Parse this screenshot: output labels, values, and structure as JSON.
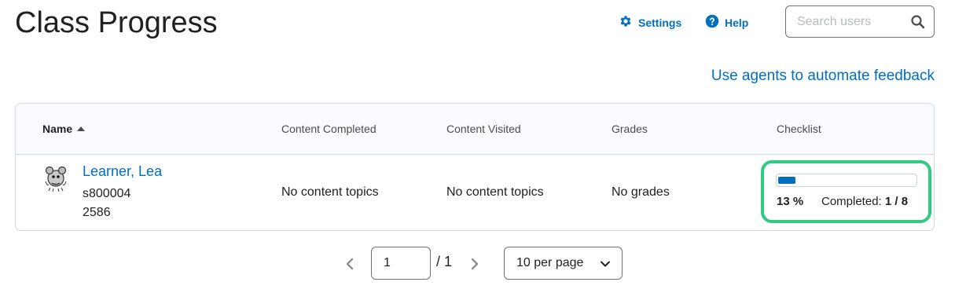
{
  "header": {
    "title": "Class Progress",
    "settings_label": "Settings",
    "help_label": "Help",
    "search_placeholder": "Search users",
    "search_value": "",
    "agents_link": "Use agents to automate feedback"
  },
  "table": {
    "columns": {
      "name": "Name",
      "content_completed": "Content Completed",
      "content_visited": "Content Visited",
      "grades": "Grades",
      "checklist": "Checklist"
    },
    "rows": [
      {
        "name": "Learner, Lea",
        "user_id": "s800004",
        "org_id": "2586",
        "content_completed": "No content topics",
        "content_visited": "No content topics",
        "grades": "No grades",
        "checklist": {
          "percent_label": "13 %",
          "completed_label": "Completed:",
          "completed_value": "1 / 8",
          "progress_fraction": 0.125
        }
      }
    ]
  },
  "pager": {
    "current_page": "1",
    "total_label": "/ 1",
    "per_page": "10 per page"
  },
  "colors": {
    "link": "#006fbf",
    "highlight": "#2ecc80",
    "progress_fill": "#006fbf"
  },
  "icons": [
    "gear-icon",
    "help-icon",
    "search-icon",
    "sort-ascending-icon",
    "user-avatar",
    "chevron-left-icon",
    "chevron-right-icon",
    "chevron-down-icon"
  ]
}
